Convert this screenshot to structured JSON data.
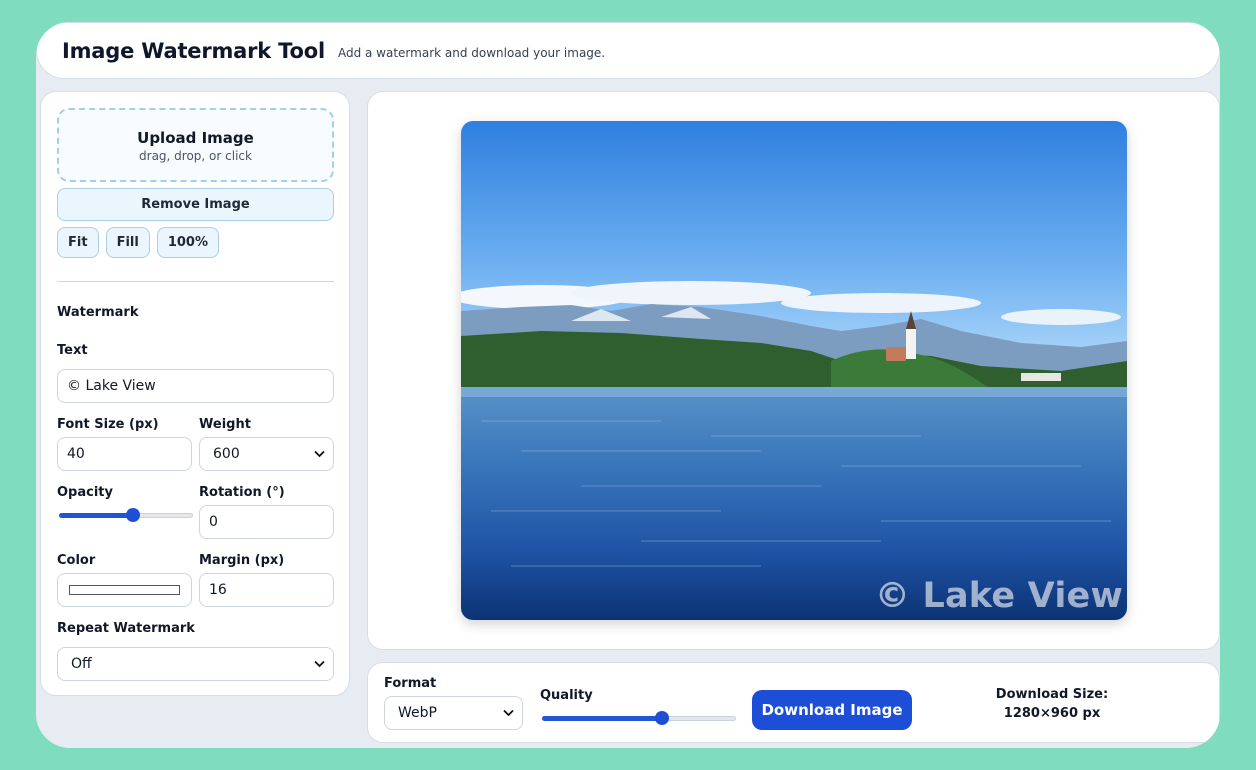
{
  "header": {
    "title": "Image Watermark Tool",
    "subtitle": "Add a watermark and download your image."
  },
  "upload": {
    "title": "Upload Image",
    "hint": "drag, drop, or click"
  },
  "remove_label": "Remove Image",
  "zoom_buttons": [
    "Fit",
    "Fill",
    "100%"
  ],
  "watermark": {
    "section_title": "Watermark",
    "text_label": "Text",
    "text_value": "© Lake View",
    "font_size_label": "Font Size (px)",
    "font_size_value": "40",
    "weight_label": "Weight",
    "weight_value": "600",
    "opacity_label": "Opacity",
    "opacity_value": 0.55,
    "rotation_label": "Rotation (°)",
    "rotation_value": "0",
    "color_label": "Color",
    "color_value": "#ffffff",
    "margin_label": "Margin (px)",
    "margin_value": "16",
    "repeat_label": "Repeat Watermark",
    "repeat_value": "Off"
  },
  "preview": {
    "watermark_text": "© Lake View"
  },
  "export": {
    "format_label": "Format",
    "format_value": "WebP",
    "quality_label": "Quality",
    "quality_value": 0.62,
    "download_label": "Download Image",
    "size_label": "Download Size:",
    "size_value": "1280×960 px"
  },
  "colors": {
    "accent": "#1d4ed8",
    "background": "#7fdcbf",
    "panel_border": "#d7dde6"
  }
}
